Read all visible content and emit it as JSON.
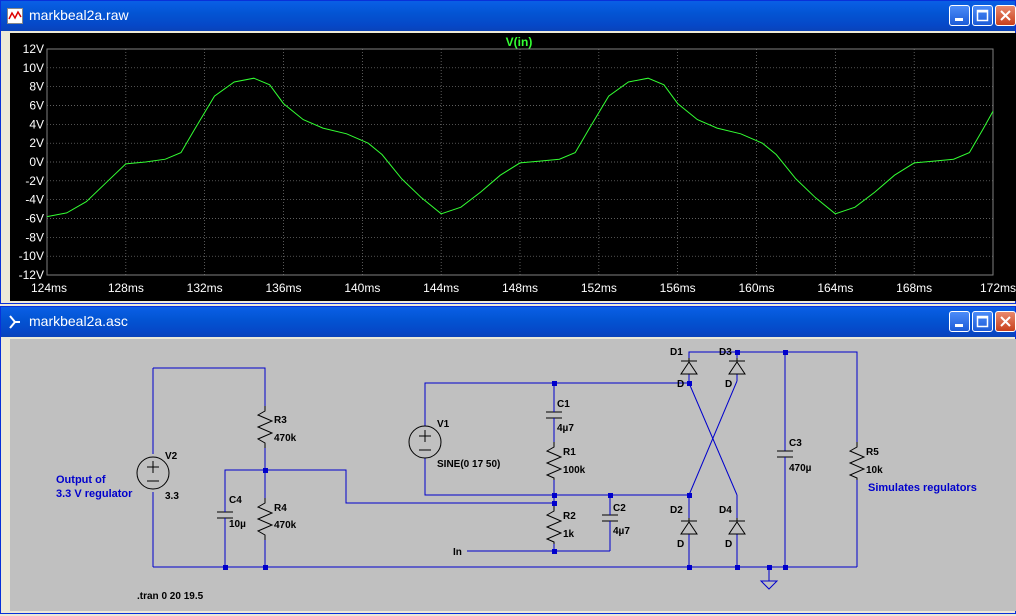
{
  "plot_window": {
    "title": "markbeal2a.raw",
    "trace_label": "V(in)",
    "colors": {
      "background": "#000000",
      "trace": "#33ff33",
      "grid": "#808080",
      "axis_text": "#ffffff"
    }
  },
  "schematic_window": {
    "title": "markbeal2a.asc",
    "colors": {
      "background": "#c0c0c0",
      "wire": "#0000cc",
      "text": "#000000",
      "comment": "#0000cc"
    },
    "components": {
      "V2": {
        "name": "V2",
        "value": "3.3"
      },
      "V1": {
        "name": "V1",
        "value": "SINE(0 17 50)"
      },
      "R3": {
        "name": "R3",
        "value": "470k"
      },
      "R4": {
        "name": "R4",
        "value": "470k"
      },
      "C4": {
        "name": "C4",
        "value": "10µ"
      },
      "C1": {
        "name": "C1",
        "value": "4µ7"
      },
      "R1": {
        "name": "R1",
        "value": "100k"
      },
      "R2": {
        "name": "R2",
        "value": "1k"
      },
      "C2": {
        "name": "C2",
        "value": "4µ7"
      },
      "D1": {
        "name": "D1",
        "value": "D"
      },
      "D2": {
        "name": "D2",
        "value": "D"
      },
      "D3": {
        "name": "D3",
        "value": "D"
      },
      "D4": {
        "name": "D4",
        "value": "D"
      },
      "C3": {
        "name": "C3",
        "value": "470µ"
      },
      "R5": {
        "name": "R5",
        "value": "10k"
      }
    },
    "comment_output_line1": "Output of",
    "comment_output_line2": "3.3 V regulator",
    "comment_simulates": "Simulates regulators",
    "net_label_in": "In",
    "directive": ".tran 0 20 19.5"
  },
  "chart_data": {
    "type": "line",
    "title": "V(in)",
    "xlabel": "",
    "ylabel": "",
    "xlim": [
      124,
      172
    ],
    "ylim": [
      -12,
      12
    ],
    "grid": true,
    "x_tick_labels": [
      "124ms",
      "128ms",
      "132ms",
      "136ms",
      "140ms",
      "144ms",
      "148ms",
      "152ms",
      "156ms",
      "160ms",
      "164ms",
      "168ms",
      "172ms"
    ],
    "y_tick_labels": [
      "12V",
      "10V",
      "8V",
      "6V",
      "4V",
      "2V",
      "0V",
      "-2V",
      "-4V",
      "-6V",
      "-8V",
      "-10V",
      "-12V"
    ],
    "series": [
      {
        "name": "V(in)",
        "x": [
          124,
          125,
          126,
          127,
          128,
          129,
          130,
          130.8,
          131.5,
          132.5,
          133.5,
          134.5,
          135.3,
          136,
          137,
          138,
          139.2,
          140.3,
          141,
          142,
          143,
          144,
          145,
          146,
          147,
          148,
          149,
          150,
          150.8,
          151.5,
          152.5,
          153.5,
          154.5,
          155.3,
          156,
          157,
          158,
          159.2,
          160.3,
          161,
          162,
          163,
          164,
          165,
          166,
          167,
          168,
          169,
          170,
          170.8,
          171.5,
          172
        ],
        "y": [
          -5.8,
          -5.4,
          -4.2,
          -2.2,
          -0.2,
          0.0,
          0.3,
          1.0,
          3.5,
          7.0,
          8.5,
          8.9,
          8.2,
          6.2,
          4.5,
          3.6,
          3.0,
          2.0,
          0.8,
          -1.8,
          -3.8,
          -5.5,
          -4.8,
          -3.2,
          -1.4,
          -0.1,
          0.1,
          0.3,
          1.0,
          3.5,
          7.0,
          8.5,
          8.9,
          8.2,
          6.2,
          4.5,
          3.6,
          3.0,
          2.0,
          0.8,
          -1.8,
          -3.8,
          -5.5,
          -4.8,
          -3.2,
          -1.4,
          -0.1,
          0.1,
          0.3,
          1.0,
          3.5,
          5.4
        ]
      }
    ]
  }
}
